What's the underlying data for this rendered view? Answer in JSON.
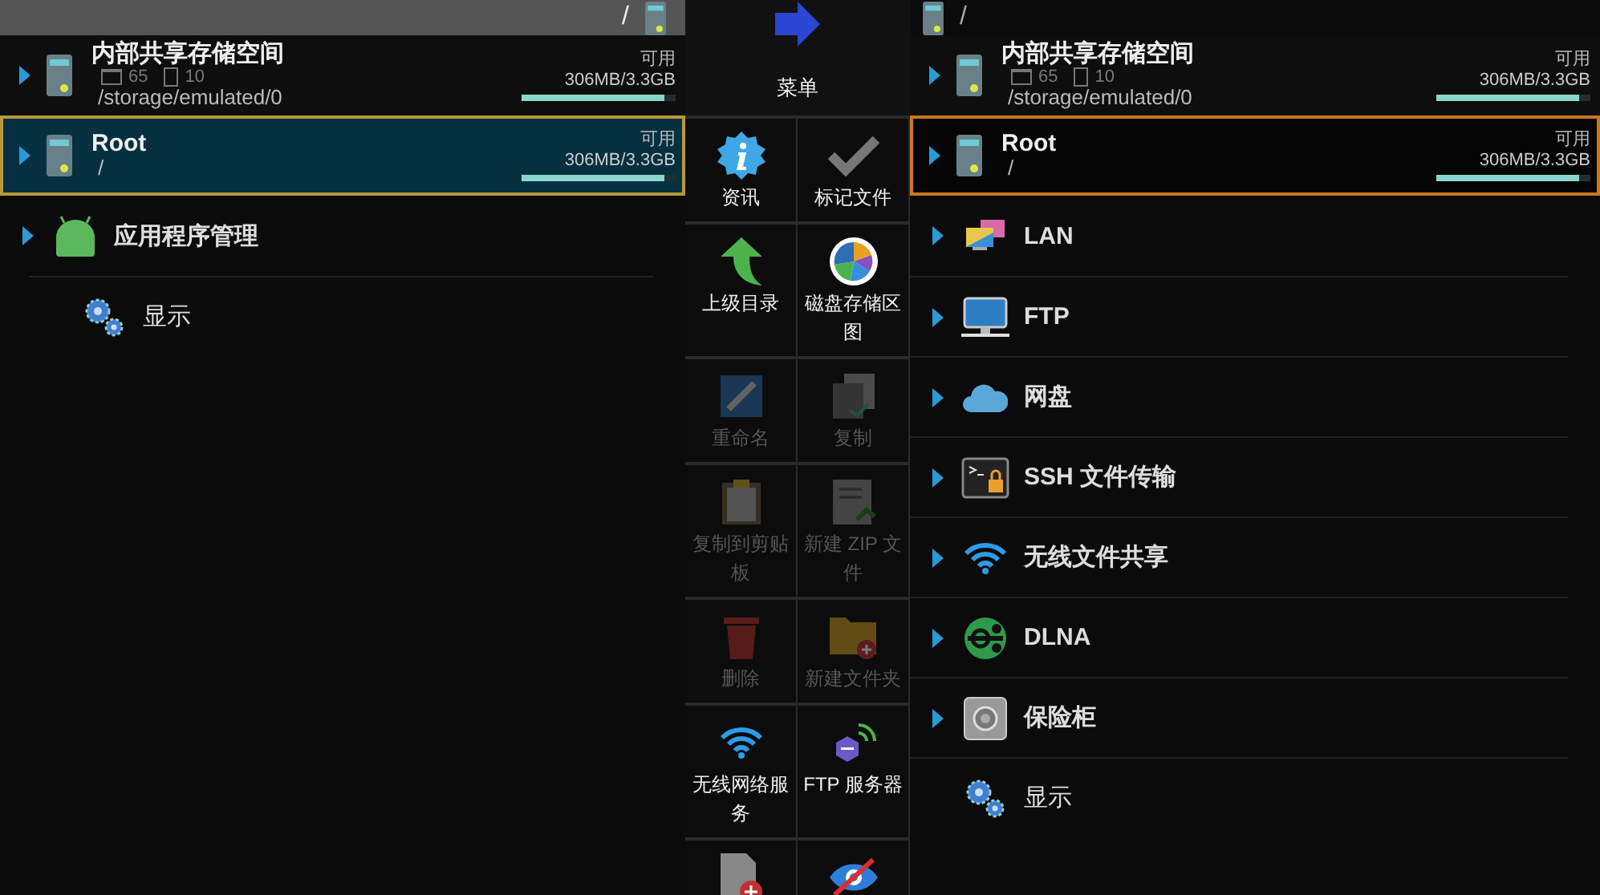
{
  "left_panel": {
    "active": true,
    "path_bar": {
      "path": "/"
    },
    "storage": [
      {
        "name": "内部共享存储空间",
        "folders": "65",
        "files": "10",
        "path": "/storage/emulated/0",
        "free_label": "可用",
        "size": "306MB/3.3GB",
        "level": 0.93,
        "selected": false
      },
      {
        "name": "Root",
        "path": "/",
        "free_label": "可用",
        "size": "306MB/3.3GB",
        "level": 0.93,
        "selected": true
      }
    ],
    "items": [
      {
        "label": "应用程序管理",
        "kind": "android",
        "expandable": true
      },
      {
        "label": "显示",
        "kind": "gears",
        "expandable": false
      }
    ]
  },
  "menu": {
    "title": "菜单",
    "items": [
      {
        "label": "资讯",
        "kind": "info",
        "disabled": false
      },
      {
        "label": "标记文件",
        "kind": "check",
        "disabled": false
      },
      {
        "label": "上级目录",
        "kind": "up",
        "disabled": false
      },
      {
        "label": "磁盘存储区图",
        "kind": "pie",
        "disabled": false
      },
      {
        "label": "重命名",
        "kind": "rename",
        "disabled": true
      },
      {
        "label": "复制",
        "kind": "copy",
        "disabled": true
      },
      {
        "label": "复制到剪贴板",
        "kind": "clipboard",
        "disabled": true
      },
      {
        "label": "新建 ZIP 文件",
        "kind": "zip",
        "disabled": true
      },
      {
        "label": "删除",
        "kind": "trash",
        "disabled": true
      },
      {
        "label": "新建文件夹",
        "kind": "folder",
        "disabled": true
      },
      {
        "label": "无线网络服务",
        "kind": "wifi",
        "disabled": false
      },
      {
        "label": "FTP 服务器",
        "kind": "ftp",
        "disabled": false
      },
      {
        "kind": "newdoc",
        "disabled": false
      },
      {
        "kind": "eye",
        "disabled": false
      }
    ]
  },
  "right_panel": {
    "active": false,
    "path_bar": {
      "path": "/"
    },
    "storage": [
      {
        "name": "内部共享存储空间",
        "folders": "65",
        "files": "10",
        "path": "/storage/emulated/0",
        "free_label": "可用",
        "size": "306MB/3.3GB",
        "level": 0.93,
        "selected": false
      },
      {
        "name": "Root",
        "path": "/",
        "free_label": "可用",
        "size": "306MB/3.3GB",
        "level": 0.93,
        "selected": true
      }
    ],
    "items": [
      {
        "label": "LAN",
        "kind": "lan",
        "expandable": true
      },
      {
        "label": "FTP",
        "kind": "monitor",
        "expandable": true
      },
      {
        "label": "网盘",
        "kind": "cloud",
        "expandable": true
      },
      {
        "label": "SSH 文件传输",
        "kind": "terminal",
        "expandable": true
      },
      {
        "label": "无线文件共享",
        "kind": "wifi",
        "expandable": true
      },
      {
        "label": "DLNA",
        "kind": "dlna",
        "expandable": true
      },
      {
        "label": "保险柜",
        "kind": "safe",
        "expandable": true
      },
      {
        "label": "显示",
        "kind": "gears",
        "expandable": false
      }
    ]
  }
}
